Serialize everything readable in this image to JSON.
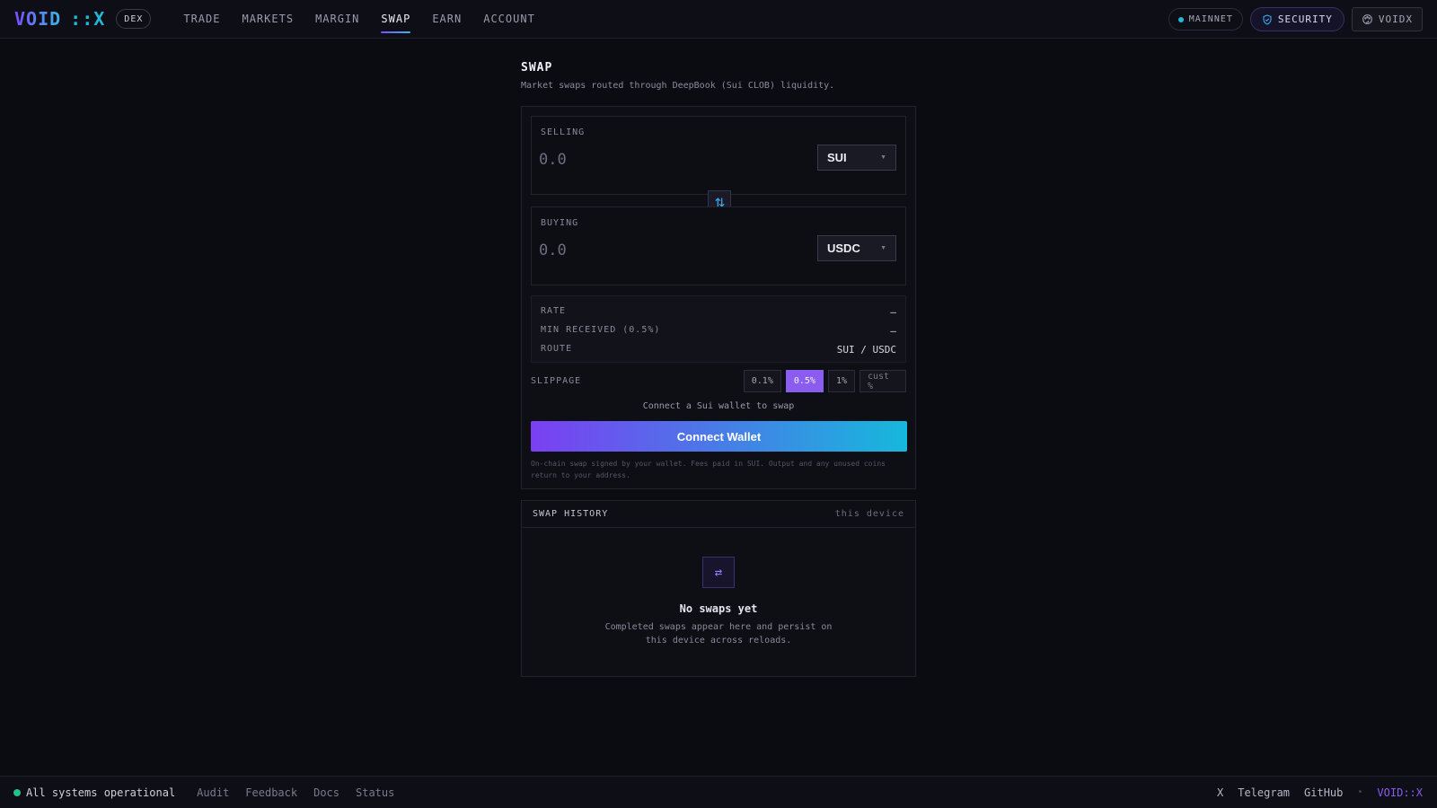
{
  "header": {
    "logo_void": "VOID",
    "logo_sep": "::X",
    "badge": "DEX",
    "nav": [
      "TRADE",
      "MARKETS",
      "MARGIN",
      "SWAP",
      "EARN",
      "ACCOUNT"
    ],
    "active_nav": "SWAP",
    "network": "MAINNET",
    "security": "SECURITY",
    "account": "VOIDX"
  },
  "swap": {
    "title": "SWAP",
    "subtitle": "Market swaps routed through DeepBook (Sui CLOB) liquidity.",
    "selling": {
      "label": "SELLING",
      "placeholder": "0.0",
      "token": "SUI"
    },
    "buying": {
      "label": "BUYING",
      "placeholder": "0.0",
      "token": "USDC"
    },
    "details": {
      "rate_label": "RATE",
      "rate_value": "—",
      "min_label": "MIN RECEIVED (0.5%)",
      "min_value": "—",
      "route_label": "ROUTE",
      "route_value": "SUI / USDC"
    },
    "slippage": {
      "label": "SLIPPAGE",
      "options": [
        "0.1%",
        "0.5%",
        "1%"
      ],
      "selected": "0.5%",
      "custom_placeholder": "cust %"
    },
    "connect_hint": "Connect a Sui wallet to swap",
    "connect_button": "Connect Wallet",
    "footnote": "On-chain swap signed by your wallet. Fees paid in SUI. Output and any unused coins return to your address."
  },
  "history": {
    "title": "SWAP HISTORY",
    "scope": "this device",
    "empty_title": "No swaps yet",
    "empty_desc": "Completed swaps appear here and persist on this device across reloads."
  },
  "footer": {
    "status": "All systems operational",
    "links": [
      "Audit",
      "Feedback",
      "Docs",
      "Status"
    ],
    "social": [
      "X",
      "Telegram",
      "GitHub"
    ],
    "bullet": "•",
    "brand": "VOID::X"
  }
}
